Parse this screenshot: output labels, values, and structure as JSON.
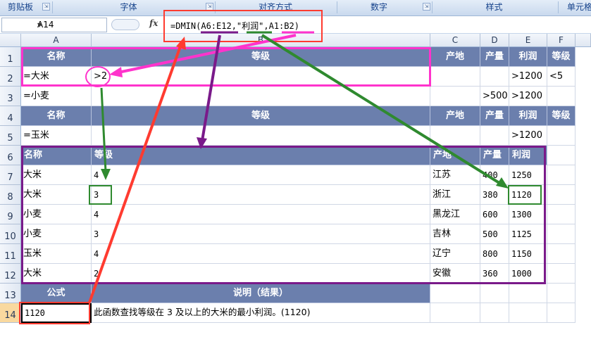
{
  "ribbon": {
    "groups": [
      "剪贴板",
      "字体",
      "对齐方式",
      "数字",
      "样式",
      "单元格"
    ]
  },
  "formula_bar": {
    "name_box": "A14",
    "fx_label": "fx",
    "formula": "=DMIN(A6:E12,\"利润\",A1:B2)"
  },
  "columns": [
    "A",
    "B",
    "C",
    "D",
    "E",
    "F"
  ],
  "rows": [
    "1",
    "2",
    "3",
    "4",
    "5",
    "6",
    "7",
    "8",
    "9",
    "10",
    "11",
    "12",
    "13",
    "14"
  ],
  "criteria_block1": {
    "header": [
      "名称",
      "等级",
      "产地",
      "产量",
      "利润",
      "等级"
    ],
    "row2": [
      "=大米",
      ">2",
      "",
      "",
      ">1200",
      "<5"
    ],
    "row3": [
      "=小麦",
      "",
      "",
      ">500",
      ">1200",
      ""
    ]
  },
  "criteria_block2": {
    "header": [
      "名称",
      "等级",
      "产地",
      "产量",
      "利润",
      "等级"
    ],
    "row5": [
      "=玉米",
      "",
      "",
      "",
      ">1200",
      ""
    ]
  },
  "database": {
    "header": [
      "名称",
      "等级",
      "产地",
      "产量",
      "利润"
    ],
    "rows": [
      [
        "大米",
        "4",
        "江苏",
        "400",
        "1250"
      ],
      [
        "大米",
        "3",
        "浙江",
        "380",
        "1120"
      ],
      [
        "小麦",
        "4",
        "黑龙江",
        "600",
        "1300"
      ],
      [
        "小麦",
        "3",
        "吉林",
        "500",
        "1125"
      ],
      [
        "玉米",
        "4",
        "辽宁",
        "800",
        "1150"
      ],
      [
        "大米",
        "2",
        "安徽",
        "360",
        "1000"
      ]
    ]
  },
  "footer": {
    "formula_header": "公式",
    "desc_header": "说明（结果）",
    "result": "1120",
    "description": "此函数查找等级在 3 及以上的大米的最小利润。(1120)"
  },
  "annotation_colors": {
    "magenta": "#ff33cc",
    "purple": "#7a1a8a",
    "green": "#2f8a2f",
    "red": "#ff3b30"
  }
}
